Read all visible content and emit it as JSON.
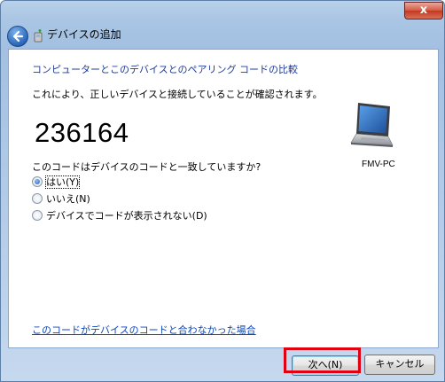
{
  "window": {
    "title": "デバイスの追加",
    "close_label": "x"
  },
  "content": {
    "heading": "コンピューターとこのデバイスとのペアリング コードの比較",
    "description": "これにより、正しいデバイスと接続していることが確認されます。",
    "pairing_code": "236164",
    "device_name": "FMV-PC",
    "question": "このコードはデバイスのコードと一致していますか?",
    "options": [
      {
        "label": "はい(Y)",
        "selected": true
      },
      {
        "label": "いいえ(N)",
        "selected": false
      },
      {
        "label": "デバイスでコードが表示されない(D)",
        "selected": false
      }
    ],
    "mismatch_link": "このコードがデバイスのコードと合わなかった場合"
  },
  "buttons": {
    "next": "次へ(N)",
    "cancel": "キャンセル"
  },
  "colors": {
    "heading": "#1e3a9c",
    "link": "#0b48bb",
    "highlight": "#e00010"
  }
}
